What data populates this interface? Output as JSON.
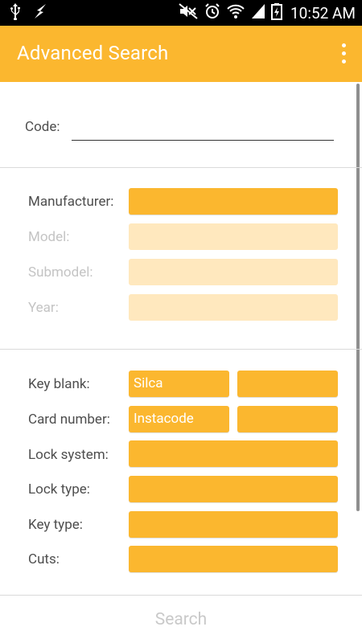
{
  "status_bar": {
    "time": "10:52 AM"
  },
  "app_bar": {
    "title": "Advanced Search"
  },
  "code_section": {
    "code_label": "Code:",
    "code_value": ""
  },
  "vehicle_section": {
    "manufacturer_label": "Manufacturer:",
    "model_label": "Model:",
    "submodel_label": "Submodel:",
    "year_label": "Year:",
    "manufacturer_value": "",
    "model_value": "",
    "submodel_value": "",
    "year_value": ""
  },
  "key_section": {
    "key_blank_label": "Key blank:",
    "key_blank_value": "Silca",
    "key_blank_value2": "",
    "card_number_label": "Card number:",
    "card_number_value": "Instacode",
    "card_number_value2": "",
    "lock_system_label": "Lock system:",
    "lock_system_value": "",
    "lock_type_label": "Lock type:",
    "lock_type_value": "",
    "key_type_label": "Key type:",
    "key_type_value": "",
    "cuts_label": "Cuts:",
    "cuts_value": ""
  },
  "search_button_label": "Search"
}
